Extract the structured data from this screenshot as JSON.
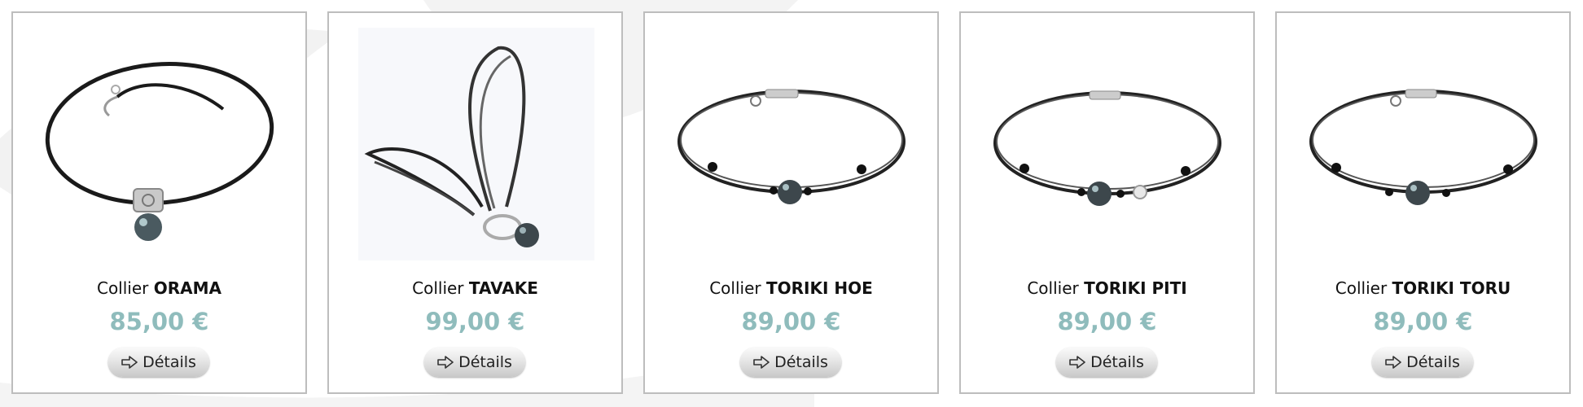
{
  "products": [
    {
      "prefix": "Collier",
      "name": "ORAMA",
      "price": "85,00 €",
      "button_label": "Détails",
      "image_icon": "necklace-orama-image"
    },
    {
      "prefix": "Collier",
      "name": "TAVAKE",
      "price": "99,00 €",
      "button_label": "Détails",
      "image_icon": "necklace-tavake-image"
    },
    {
      "prefix": "Collier",
      "name": "TORIKI HOE",
      "price": "89,00 €",
      "button_label": "Détails",
      "image_icon": "necklace-toriki-hoe-image"
    },
    {
      "prefix": "Collier",
      "name": "TORIKI PITI",
      "price": "89,00 €",
      "button_label": "Détails",
      "image_icon": "necklace-toriki-piti-image"
    },
    {
      "prefix": "Collier",
      "name": "TORIKI TORU",
      "price": "89,00 €",
      "button_label": "Détails",
      "image_icon": "necklace-toriki-toru-image"
    }
  ],
  "colors": {
    "price": "#8fbcbc",
    "card_border": "#bdbdbd",
    "background_shape": "#f2f2f2"
  }
}
